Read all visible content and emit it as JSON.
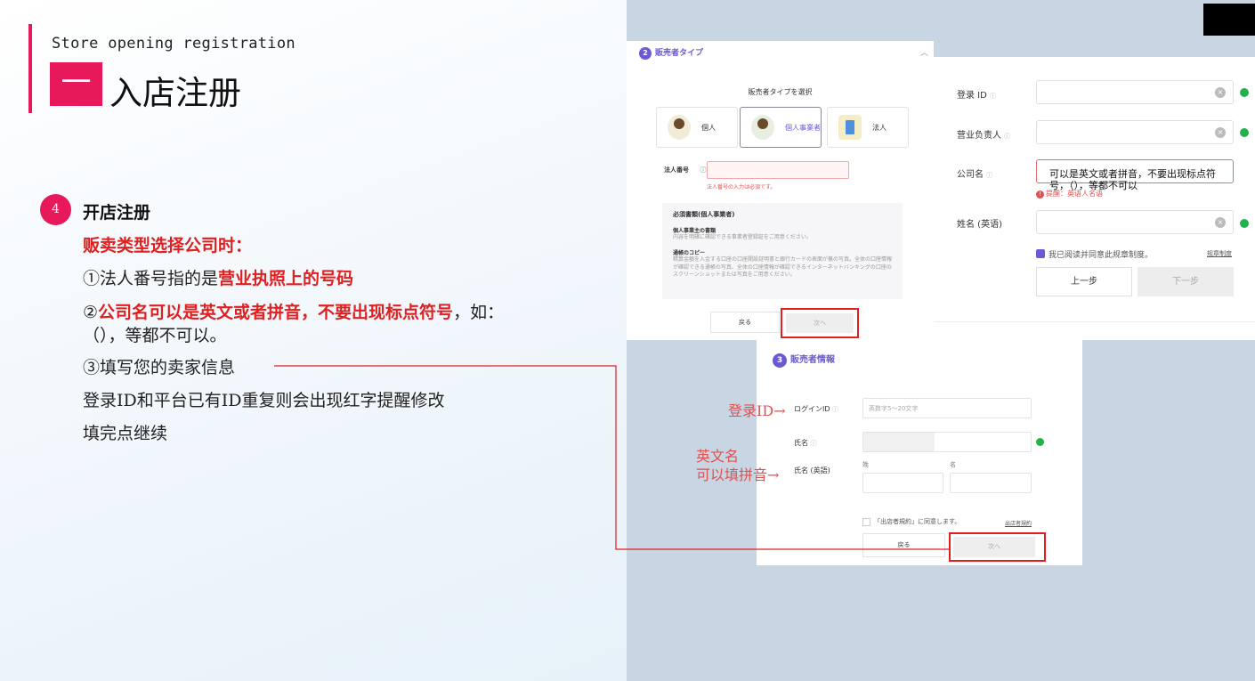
{
  "slide": {
    "subtitle": "Store opening registration",
    "section_number": "一",
    "title": "入店注册",
    "step_number": "4",
    "step_title": "开店注册",
    "line_company": "贩卖类型选择公司时：",
    "line1_prefix": "①法人番号指的是",
    "line1_highlight": "营业执照上的号码",
    "line2_prefix": "②",
    "line2_highlight": "公司名可以是英文或者拼音，不要出现标点符号",
    "line2_suffix": "，如：",
    "line2_cont": "（），等都不可以。",
    "line3": "③填写您的卖家信息",
    "line4": "登录ID和平台已有ID重复则会出现红字提醒修改",
    "line5": "填完点继续"
  },
  "panel1": {
    "step_badge": "2",
    "header": "販売者タイプ",
    "chevron": "︿",
    "select_title": "販売者タイプを選択",
    "types": [
      "個人",
      "個人事業者",
      "法人"
    ],
    "field_label": "法人番号",
    "help": "ⓘ",
    "field_error": "法人番号の入力は必須です。",
    "doc_title": "必須書類(個人事業者)",
    "doc1_title": "個人事業主の書類",
    "doc1_text": "内容を明確に確認できる事業者登録証をご用意ください。",
    "doc2_title": "通帳のコピー",
    "doc2_text": "精算金額を入金する口座の口座開設証明書と銀行カードの表面が裏の写真。全体の口座情報が確認できる通帳の写真、全体の口座情報が確認できるインターネットバンキングの口座のスクリーンショットまたは写真をご用意ください。",
    "back_button": "戻る",
    "next_button": "次へ"
  },
  "panel2": {
    "labels": [
      "登录 ID",
      "营业负责人",
      "公司名",
      "姓名 (英语)"
    ],
    "help": "ⓘ",
    "clear": "×",
    "company_value": "可以是英文或者拼音，不要出现标点符号，（），等都不可以",
    "error": "提醒：英语人名语",
    "agree_text": "我已阅读并同意此规章制度。",
    "rule_link": "规章制度",
    "prev_button": "上一步",
    "next_button": "下一步"
  },
  "panel3": {
    "step_badge": "3",
    "header": "販売者情報",
    "login_label": "ログインID",
    "login_placeholder": "英数字5～20文字",
    "name_label": "氏名",
    "name_en_label": "氏名 (英語)",
    "help": "ⓘ",
    "last_name": "姓",
    "first_name": "名",
    "agree_text": "「出店者規約」に同意します。",
    "terms_link": "出店者規約",
    "back_button": "戻る",
    "next_button": "次へ"
  },
  "annotations": {
    "login_id": "登录ID",
    "arrow1": "→",
    "name_line1": "英文名",
    "name_line2": "可以填拼音",
    "arrow2": "→"
  },
  "colors": {
    "accent": "#e8195a",
    "highlight_red": "#e02020",
    "brand_purple": "#6a5bd4",
    "success_green": "#22b14c"
  }
}
